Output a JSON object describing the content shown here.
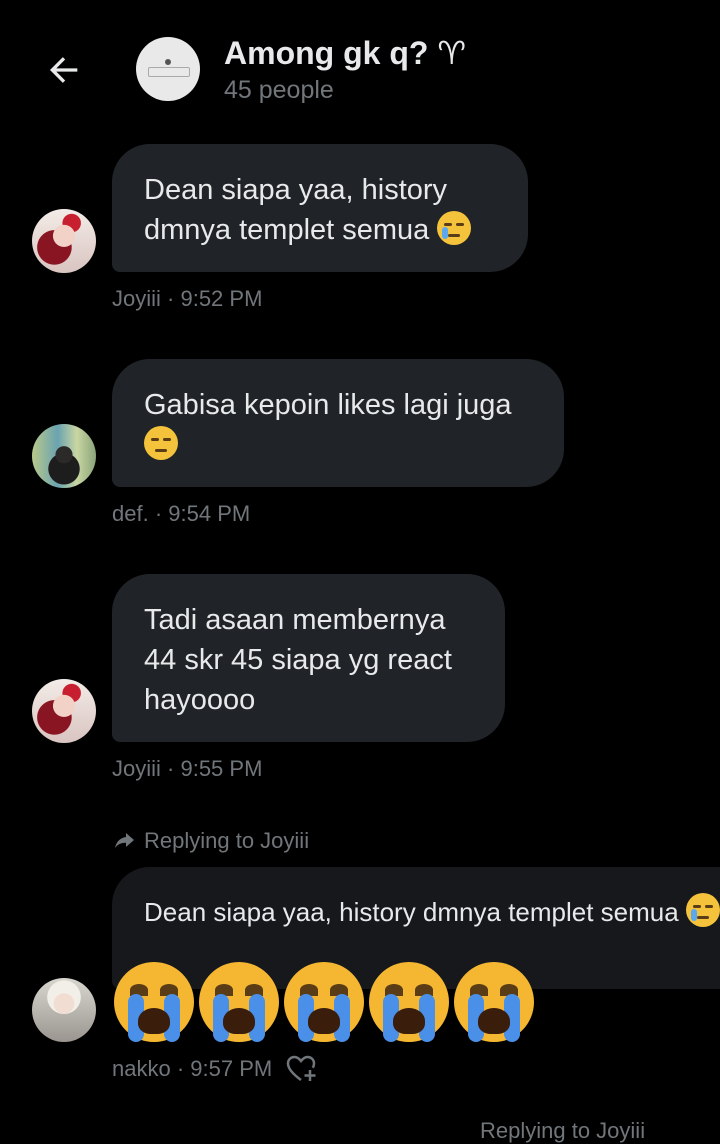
{
  "header": {
    "title": "Among gk q? ♈",
    "subtitle": "45 people"
  },
  "messages": [
    {
      "text_line1": "Dean siapa yaa, history",
      "text_line2": "dmnya templet semua",
      "sender": "Joyiii",
      "time": "9:52 PM"
    },
    {
      "text_line1": "Gabisa kepoin likes lagi juga",
      "sender": "def.",
      "time": "9:54 PM"
    },
    {
      "text_line1": "Tadi asaan membernya",
      "text_line2": "44 skr 45 siapa yg react",
      "text_line3": "hayoooo",
      "sender": "Joyiii",
      "time": "9:55 PM"
    }
  ],
  "reply": {
    "context": "Replying to Joyiii",
    "quoted_text": "Dean siapa yaa, history dmnya templet semua",
    "sender": "nakko",
    "time": "9:57 PM",
    "emoji_count": 5
  },
  "bottom_reply": "Replying to Joyiii",
  "meta_separator": " · ",
  "icons": {
    "back": "arrow-left-icon",
    "reply_arrow": "reply-arrow-icon",
    "add_reaction": "heart-plus-icon"
  },
  "colors": {
    "background": "#000000",
    "bubble": "#202327",
    "text": "#e7e9ea",
    "muted": "#71767b"
  }
}
